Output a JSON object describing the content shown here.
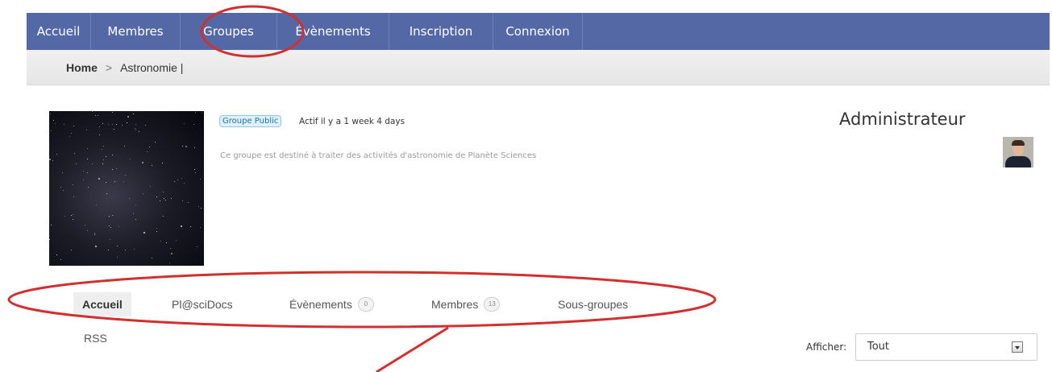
{
  "nav": {
    "items": [
      {
        "label": "Accueil"
      },
      {
        "label": "Membres"
      },
      {
        "label": "Groupes"
      },
      {
        "label": "Évènements"
      },
      {
        "label": "Inscription"
      },
      {
        "label": "Connexion"
      }
    ],
    "color": "#5468a6"
  },
  "breadcrumb": {
    "home": "Home",
    "separator": ">",
    "current": "Astronomie |"
  },
  "group": {
    "badge": "Groupe Public",
    "activity": "Actif il y a 1 week  4 days",
    "description": "Ce groupe est destiné à traiter des activités d'astronomie de Planète Sciences"
  },
  "admin": {
    "title": "Administrateur"
  },
  "tabs": [
    {
      "label": "Accueil"
    },
    {
      "label": "Pl@sciDocs"
    },
    {
      "label": "Évènements",
      "count": "0"
    },
    {
      "label": "Membres",
      "count": "13"
    },
    {
      "label": "Sous-groupes"
    }
  ],
  "rss": "RSS",
  "filter": {
    "label": "Afficher:",
    "value": "Tout"
  },
  "annotation": {
    "color": "#d32f2f"
  }
}
